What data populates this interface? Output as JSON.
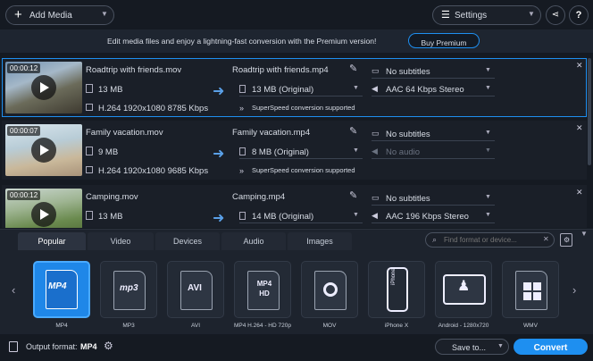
{
  "toolbar": {
    "add_media": "Add Media",
    "settings": "Settings",
    "help": "?"
  },
  "promo": {
    "text": "Edit media files and enjoy a lightning-fast conversion with the Premium version!",
    "button": "Buy Premium"
  },
  "files": [
    {
      "time": "00:00:12",
      "name": "Roadtrip with friends.mov",
      "size": "13 MB",
      "codec": "H.264 1920x1080 8785 Kbps",
      "out_name": "Roadtrip with friends.mp4",
      "out_size": "13 MB (Original)",
      "subtitles": "No subtitles",
      "audio": "AAC 64 Kbps Stereo",
      "note": "SuperSpeed conversion supported"
    },
    {
      "time": "00:00:07",
      "name": "Family vacation.mov",
      "size": "9 MB",
      "codec": "H.264 1920x1080 9685 Kbps",
      "out_name": "Family vacation.mp4",
      "out_size": "8 MB (Original)",
      "subtitles": "No subtitles",
      "audio": "No audio",
      "note": "SuperSpeed conversion supported"
    },
    {
      "time": "00:00:12",
      "name": "Camping.mov",
      "size": "13 MB",
      "codec": "",
      "out_name": "Camping.mp4",
      "out_size": "14 MB (Original)",
      "subtitles": "No subtitles",
      "audio": "AAC 196 Kbps Stereo",
      "note": ""
    }
  ],
  "tabs": [
    "Popular",
    "Video",
    "Devices",
    "Audio",
    "Images"
  ],
  "search": {
    "placeholder": "Find format or device..."
  },
  "formats": [
    {
      "badge": "MP4",
      "caption": "MP4"
    },
    {
      "badge": "mp3",
      "caption": "MP3"
    },
    {
      "badge": "AVI",
      "caption": "AVI"
    },
    {
      "badge": "MP4 HD",
      "caption": "MP4 H.264 - HD 720p"
    },
    {
      "badge": "MOV",
      "caption": "MOV"
    },
    {
      "badge": "iPhone",
      "caption": "iPhone X"
    },
    {
      "badge": "android",
      "caption": "Android - 1280x720"
    },
    {
      "badge": "WMV",
      "caption": "WMV"
    }
  ],
  "footer": {
    "label": "Output format:",
    "format": "MP4",
    "save_to": "Save to...",
    "convert": "Convert"
  },
  "colors": {
    "accent": "#1e8ff0",
    "bg": "#151a22"
  }
}
